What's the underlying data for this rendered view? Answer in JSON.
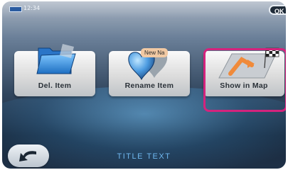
{
  "status_bar": {
    "time": "12:34",
    "ok_label": "OK",
    "battery_icon": "battery-icon"
  },
  "tiles": [
    {
      "label": "Del. Item",
      "icon": "folder-icon"
    },
    {
      "label": "Rename Item",
      "icon": "heart-icon",
      "badge": "New Na"
    },
    {
      "label": "Show in Map",
      "icon": "map-flag-icon"
    }
  ],
  "footer": {
    "title": "TITLE TEXT",
    "back_icon": "back-arrow-icon"
  },
  "colors": {
    "highlight": "#d4237d",
    "title_text": "#6fb7ee"
  }
}
